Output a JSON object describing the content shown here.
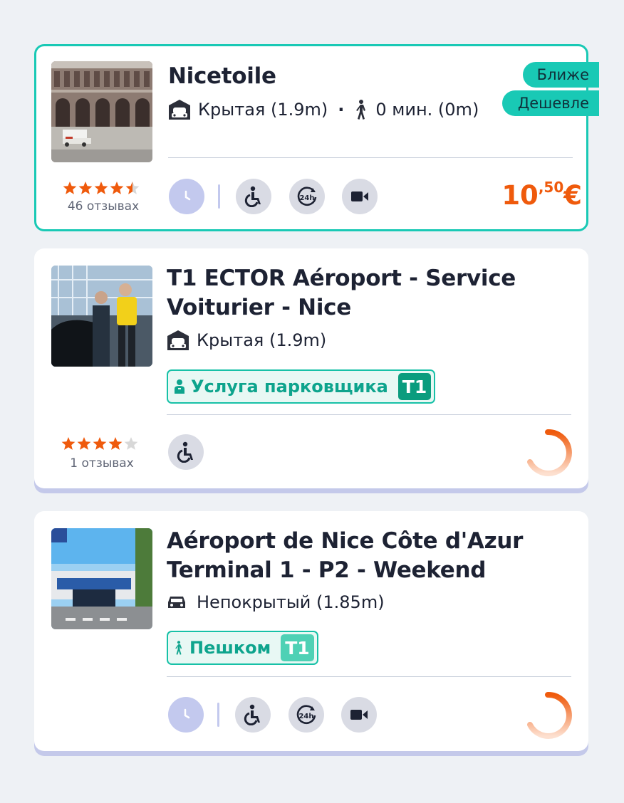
{
  "colors": {
    "accent": "#19c9b5",
    "price": "#ef5a0c",
    "star": "#ef5a0c",
    "chip": "#17c1a7"
  },
  "cards": [
    {
      "title": "Nicetoile",
      "parking_type": "Крытая (1.9m)",
      "walk": "0 мин. (0m)",
      "badges": [
        "Ближе",
        "Дешевле"
      ],
      "rating": 4.5,
      "reviews": "46 отзывах",
      "price_main": "10",
      "price_frac": ",50",
      "price_currency": "€",
      "features": [
        "clock-icon",
        "wheelchair-icon",
        "24h-icon",
        "camera-icon"
      ]
    },
    {
      "title_line1": "T1 ECTOR Aéroport - Service",
      "title_line2": "Voiturier - Nice",
      "parking_type": "Крытая (1.9m)",
      "chip_label": "Услуга парковщика",
      "chip_tag": "T1",
      "rating": 4,
      "reviews": "1 отзывах",
      "features": [
        "wheelchair-icon"
      ]
    },
    {
      "title_line1": "Aéroport de Nice Côte d'Azur",
      "title_line2": "Terminal 1 - P2 - Weekend",
      "parking_type": "Непокрытый (1.85m)",
      "chip_label": "Пешком",
      "chip_tag": "T1",
      "features": [
        "clock-icon",
        "wheelchair-icon",
        "24h-icon",
        "camera-icon"
      ]
    }
  ]
}
